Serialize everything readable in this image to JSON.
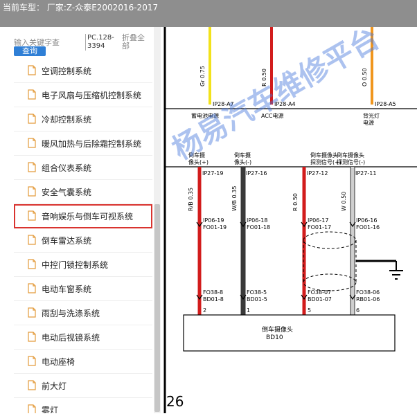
{
  "header": {
    "title": "当前车型： 厂家:Z-众泰E2002016-2017"
  },
  "sidebar": {
    "search_placeholder": "输入关键字查",
    "query_label": "查询",
    "pc_code": "PC.128-3394",
    "fold_label": "折叠全部",
    "items": [
      {
        "label": "空调控制系统"
      },
      {
        "label": "电子风扇与压缩机控制系统"
      },
      {
        "label": "冷却控制系统"
      },
      {
        "label": "暖风加热与后除霜控制系统"
      },
      {
        "label": "组合仪表系统"
      },
      {
        "label": "安全气囊系统"
      },
      {
        "label": "音响娱乐与倒车可视系统"
      },
      {
        "label": "倒车雷达系统"
      },
      {
        "label": "中控门锁控制系统"
      },
      {
        "label": "电动车窗系统"
      },
      {
        "label": "雨刮与洗涤系统"
      },
      {
        "label": "电动后视镜系统"
      },
      {
        "label": "电动座椅"
      },
      {
        "label": "前大灯"
      },
      {
        "label": "雾灯"
      }
    ],
    "selected_index": 6
  },
  "diagram": {
    "top_wires": [
      {
        "label": "Gr 0.75",
        "color": "#f2e21b"
      },
      {
        "label": "R 0.50",
        "color": "#d21c1c"
      },
      {
        "label": "O 0.50",
        "color": "#f0961e"
      }
    ],
    "top_pins": [
      "IP28-A7",
      "IP28-A4",
      "IP28-A5"
    ],
    "top_captions": [
      "蓄电池电源",
      "ACC电源",
      "背光灯",
      "电源"
    ],
    "signal_labels": [
      [
        "倒车摄",
        "像头(+)"
      ],
      [
        "倒车摄",
        "像头(-)"
      ],
      [
        "倒车摄像头",
        "探测信号(+)"
      ],
      [
        "倒车摄像头",
        "探测信号(-)"
      ]
    ],
    "mid_pins": [
      "IP27-19",
      "IP27-16",
      "IP27-12",
      "IP27-11"
    ],
    "mid_wires": [
      {
        "label": "R/B 0.35",
        "color": "#d21c1c"
      },
      {
        "label": "W/B 0.35",
        "color": "#3a3a3a"
      },
      {
        "label": "R 0.50",
        "color": "#d21c1c"
      },
      {
        "label": "W 0.50",
        "color": "#cfcfcf"
      }
    ],
    "conn1": [
      [
        "IP06-19",
        "FO01-19"
      ],
      [
        "IP06-18",
        "FO01-18"
      ],
      [
        "IP06-17",
        "FO01-17"
      ],
      [
        "IP06-16",
        "FO01-16"
      ]
    ],
    "conn2": [
      [
        "FO38-8",
        "BD01-8"
      ],
      [
        "FO38-5",
        "BD01-5"
      ],
      [
        "FO38-07",
        "BD01-07"
      ],
      [
        "FO38-06",
        "RB01-06"
      ]
    ],
    "pin_numbers": [
      "2",
      "1",
      "5",
      "6"
    ],
    "camera_name": "倒车摄像头",
    "camera_code": "BD10",
    "page_number": "26",
    "watermark": "杨易汽车维修平台"
  }
}
